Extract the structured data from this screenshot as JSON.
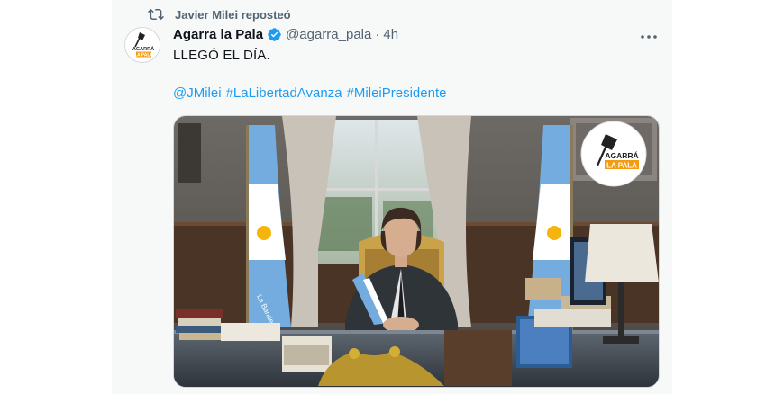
{
  "repost": {
    "icon": "repost-icon",
    "text": "Javier Milei reposteó"
  },
  "author": {
    "display_name": "Agarra la Pala",
    "handle": "@agarra_pala",
    "separator": "·",
    "time": "4h",
    "verified_icon": "verified-badge-icon",
    "avatar_icon": "shovel-logo-icon",
    "avatar_text_top": "AGARRÁ",
    "avatar_text_bottom": "LA PALA"
  },
  "tweet": {
    "text": "LLEGÓ EL DÍA.",
    "hashtags": [
      "@JMilei",
      "#LaLibertadAvanza",
      "#MileiPresidente"
    ]
  },
  "menu": {
    "icon": "more-options-icon"
  },
  "media": {
    "watermark_top": "AGARRÁ",
    "watermark_bottom": "LA PALA",
    "flag_text": "La Bandera"
  },
  "colors": {
    "accent": "#1d9bf0",
    "secondary_text": "#536471",
    "primary_text": "#0f1419",
    "card_bg": "#f7f9f9",
    "flag_blue": "#74acdf",
    "flag_sun": "#f6b40e",
    "logo_orange": "#f39c12"
  }
}
